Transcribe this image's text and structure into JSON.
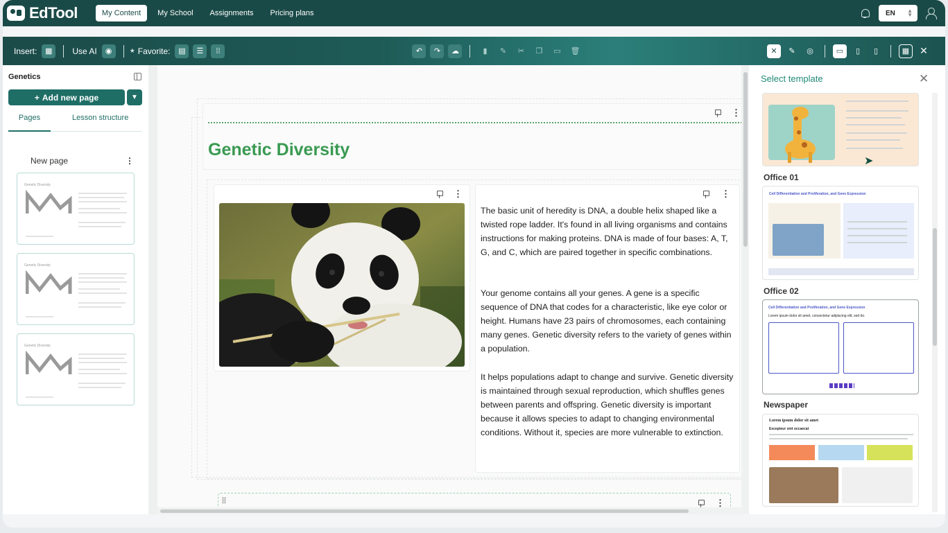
{
  "app": {
    "logo": "EdTool"
  },
  "nav": {
    "links": [
      "My Content",
      "My School",
      "Assignments",
      "Pricing plans"
    ],
    "active": "My Content",
    "language": "EN"
  },
  "toolbar": {
    "insert_label": "Insert:",
    "use_ai_label": "Use AI",
    "favorite_label": "Favorite:"
  },
  "left_panel": {
    "title": "Genetics",
    "add_page_label": "Add new page",
    "tabs": [
      "Pages",
      "Lesson structure"
    ],
    "page_name": "New page",
    "thumbnail_title": "Genetic Diversity"
  },
  "content": {
    "heading": "Genetic Diversity",
    "paragraphs": [
      "The basic unit of heredity is DNA, a double helix shaped like a twisted rope ladder. It's found in all living organisms and contains instructions for making proteins. DNA is made of four bases: A, T, G, and C, which are paired together in specific combinations.",
      "Your genome contains all your genes. A gene is a specific sequence of DNA that codes for a characteristic, like eye color or height. Humans have 23 pairs of chromosomes, each containing many genes. Genetic diversity refers to the variety of genes within a population.",
      "It helps populations adapt to change and survive. Genetic diversity is maintained through sexual reproduction, which shuffles genes between parents and offspring. Genetic diversity is important because it allows species to adapt to changing environmental conditions. Without it, species are more vulnerable to extinction."
    ]
  },
  "right_panel": {
    "title": "Select template",
    "templates": [
      {
        "name": "Office 01",
        "preview_title": "Cell Differentiation and Proliferation, and Gene Expression"
      },
      {
        "name": "Office 02",
        "preview_title": "Cell Differentiation and Proliferation, and Gene Expression",
        "preview_subtitle": "Lorem ipsum dolor sit amet, consectetur adipiscing elit, sed do."
      },
      {
        "name": "Newspaper",
        "preview_title": "Lorem ipsum dolor sit amet",
        "preview_subtitle": "Excepteur sint occaecat"
      }
    ]
  },
  "colors": {
    "brand": "#1a4a47",
    "accent": "#1f6e66",
    "heading": "#3a9a52"
  }
}
